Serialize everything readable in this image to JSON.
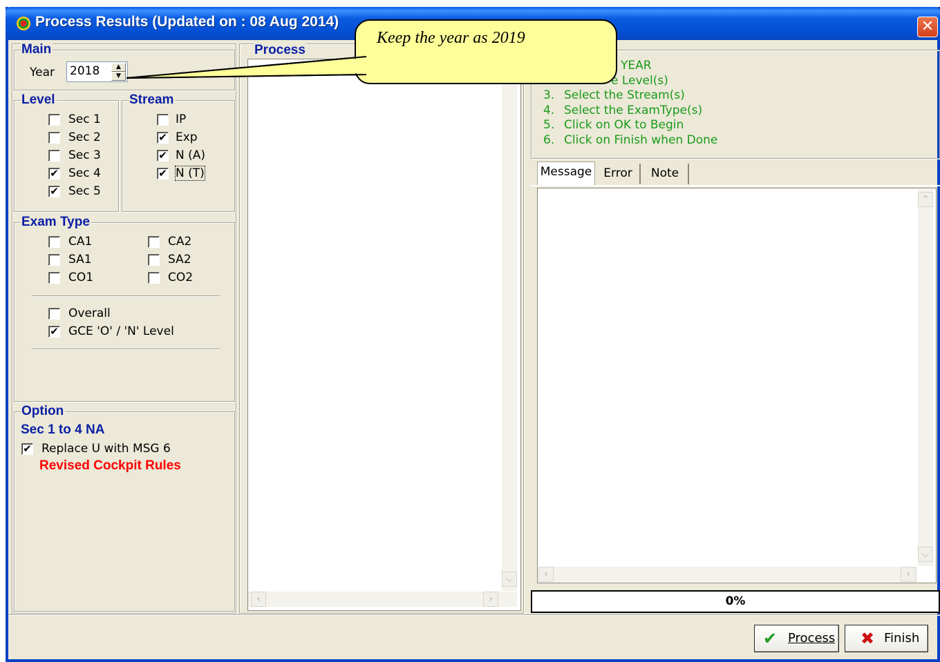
{
  "window": {
    "title": "Process Results (Updated on : 08 Aug 2014)",
    "close_symbol": "✕",
    "app_icon": "app-logo-icon"
  },
  "main": {
    "group_title": "Main",
    "year_label": "Year",
    "year_value": "2018"
  },
  "level": {
    "group_title": "Level",
    "items": [
      {
        "label": "Sec 1",
        "checked": false
      },
      {
        "label": "Sec 2",
        "checked": false
      },
      {
        "label": "Sec 3",
        "checked": false
      },
      {
        "label": "Sec 4",
        "checked": true
      },
      {
        "label": "Sec 5",
        "checked": true
      }
    ]
  },
  "stream": {
    "group_title": "Stream",
    "items": [
      {
        "label": "IP",
        "checked": false
      },
      {
        "label": "Exp",
        "checked": true
      },
      {
        "label": "N (A)",
        "checked": true
      },
      {
        "label": "N (T)",
        "checked": true
      }
    ]
  },
  "exam_type": {
    "group_title": "Exam Type",
    "items": [
      {
        "label": "CA1",
        "checked": false
      },
      {
        "label": "CA2",
        "checked": false
      },
      {
        "label": "SA1",
        "checked": false
      },
      {
        "label": "SA2",
        "checked": false
      },
      {
        "label": "CO1",
        "checked": false
      },
      {
        "label": "CO2",
        "checked": false
      }
    ],
    "overall": {
      "label": "Overall",
      "checked": false
    },
    "gce": {
      "label": "GCE 'O' / 'N' Level",
      "checked": true
    }
  },
  "option": {
    "group_title": "Option",
    "heading": "Sec 1 to 4 NA",
    "replace": {
      "label": "Replace U with MSG 6",
      "checked": true
    },
    "note": "Revised Cockpit Rules",
    "note_color": "#ff0000"
  },
  "process_panel": {
    "group_title": "Process"
  },
  "instructions": {
    "step1_visible": "YEAR",
    "step2_visible": "e Level(s)",
    "steps": [
      {
        "num": "3.",
        "text": "Select the Stream(s)"
      },
      {
        "num": "4.",
        "text": "Select the ExamType(s)"
      },
      {
        "num": "5.",
        "text": "Click on OK to Begin"
      },
      {
        "num": "6.",
        "text": "Click on Finish when Done"
      }
    ],
    "color": "#1b9a1b"
  },
  "tabs": [
    {
      "label": "Message",
      "active": true
    },
    {
      "label": "Error",
      "active": false
    },
    {
      "label": "Note",
      "active": false
    }
  ],
  "progress": {
    "text": "0%",
    "value": 0
  },
  "buttons": {
    "process": "Process",
    "finish": "Finish"
  },
  "callout": {
    "text": "Keep the year as 2019"
  },
  "checkmark": "✔",
  "icons": {
    "check": "check-icon",
    "cross": "x-icon",
    "spinner": "spin-up-down-icon"
  }
}
